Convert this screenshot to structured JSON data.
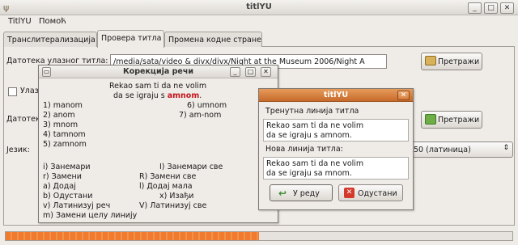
{
  "main_window": {
    "title": "titlYU",
    "menu": [
      "TitlYU",
      "Помоћ"
    ],
    "tabs": [
      "Транслитерализација",
      "Провера титла",
      "Промена кодне стране"
    ],
    "input_file_label": "Датотека улазног титла:",
    "input_file_value": "/media/sata/video & divx/divx/Night at the Museum 2006/Night A",
    "browse_label": "Претражи",
    "checkbox_label": "Улазн",
    "output_file_label": "Датотек",
    "browse2_label": "Претражи",
    "language_label": "Језик:",
    "language_value": "50 (латиница)",
    "progress": 0.5
  },
  "correction_dialog": {
    "title": "Корекција речи",
    "line1": "Rekao sam ti da ne volim",
    "line2_pre": "da se igraju s ",
    "line2_word": "amnom",
    "line2_post": ".",
    "suggestions": [
      "1) manom",
      "2) anom",
      "3) mnom",
      "4) tamnom",
      "5) zamnom",
      "6) umnom",
      "7) am-nom"
    ],
    "actions": [
      "i) Занемари",
      "I) Занемари све",
      "r) Замени",
      "R) Замени све",
      "a) Додај",
      "l) Додај мала",
      "b) Одустани",
      "x) Изађи",
      "v) Латинизуј реч",
      "V) Латинизуј све",
      "m) Замени целу линију"
    ]
  },
  "titlyu_dialog": {
    "title": "titlYU",
    "current_line_label": "Тренутна линија титла",
    "current_line_1": "Rekao sam ti da ne volim",
    "current_line_2": "da se igraju s amnom.",
    "new_line_label": "Нова линија титла:",
    "new_line_1": "Rekao sam ti da ne volim",
    "new_line_2": "da se igraju sa mnom.",
    "ok_label": "У реду",
    "cancel_label": "Одустани"
  }
}
